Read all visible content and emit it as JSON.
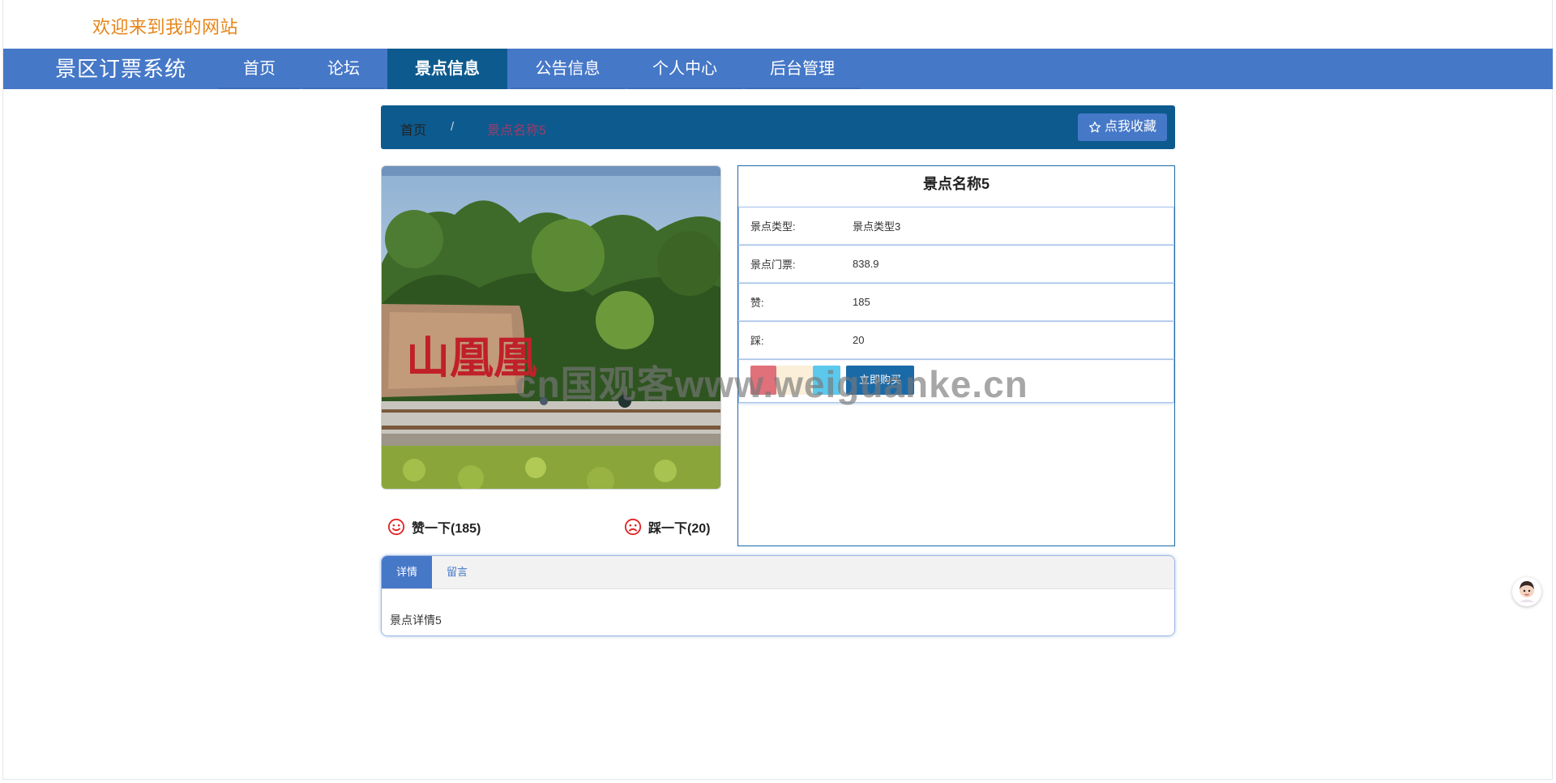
{
  "header": {
    "welcome": "欢迎来到我的网站"
  },
  "navbar": {
    "brand": "景区订票系统",
    "items": [
      {
        "label": "首页",
        "active": false
      },
      {
        "label": "论坛",
        "active": false
      },
      {
        "label": "景点信息",
        "active": true
      },
      {
        "label": "公告信息",
        "active": false
      },
      {
        "label": "个人中心",
        "active": false
      },
      {
        "label": "后台管理",
        "active": false
      }
    ]
  },
  "breadcrumb": {
    "home": "首页",
    "separator": "/",
    "current": "景点名称5",
    "favorite_label": "点我收藏",
    "favorite_icon": "star-outline-icon"
  },
  "detail": {
    "title": "景点名称5",
    "rows": [
      {
        "label": "景点类型:",
        "value": "景点类型3"
      },
      {
        "label": "景点门票:",
        "value": "838.9"
      },
      {
        "label": "赞:",
        "value": "185"
      },
      {
        "label": "踩:",
        "value": "20"
      }
    ],
    "buy_label": "立即购买"
  },
  "votes": {
    "like_label": "赞一下(185)",
    "like_icon": "smile-icon",
    "dislike_label": "踩一下(20)",
    "dislike_icon": "frown-icon"
  },
  "tabs": {
    "items": [
      {
        "label": "详情",
        "active": true
      },
      {
        "label": "留言",
        "active": false
      }
    ],
    "content": "景点详情5"
  },
  "watermark": "cn国观客www.weiguanke.cn",
  "colors": {
    "navbar": "#4678c8",
    "active_nav": "#0d5a8e",
    "welcome_text": "#e6861b",
    "icon_red": "#e02424"
  }
}
